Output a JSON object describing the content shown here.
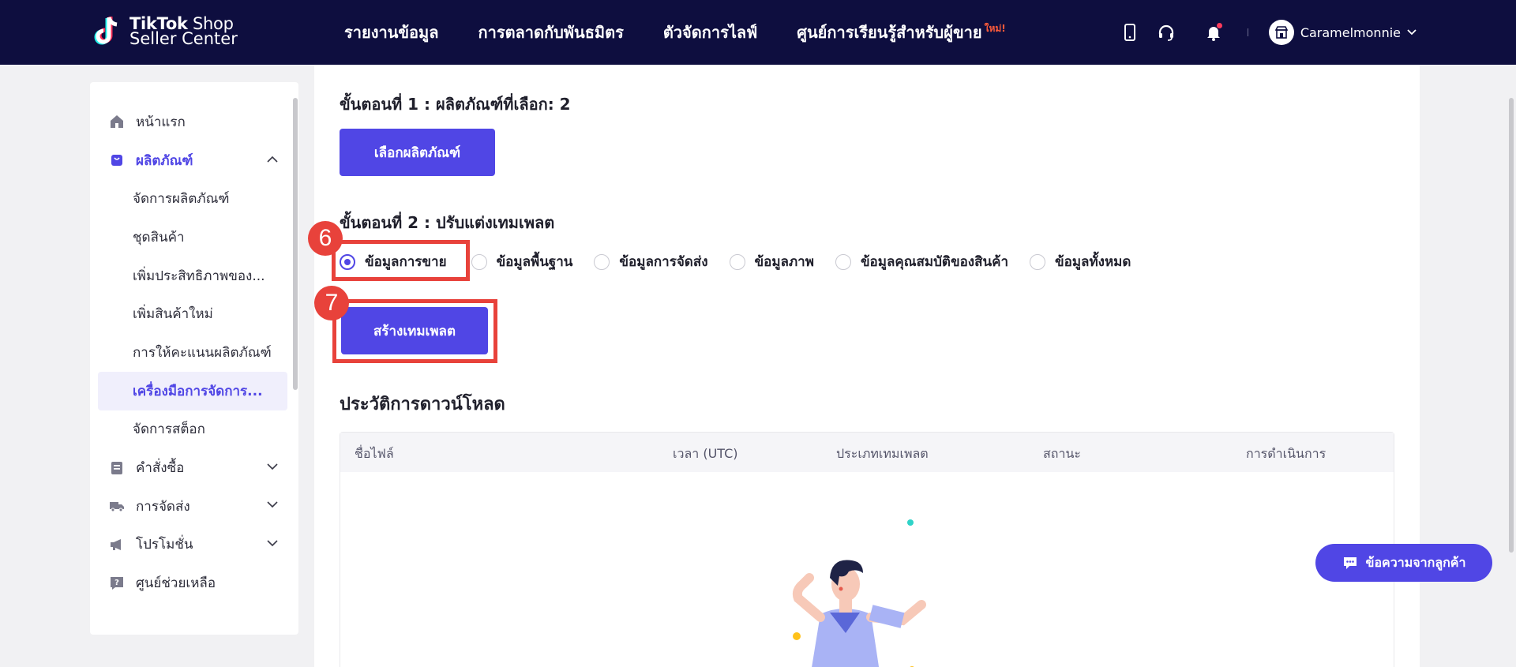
{
  "header": {
    "logo_line1_bold": "TikTok",
    "logo_line1_rest": " Shop",
    "logo_line2": "Seller Center",
    "nav": [
      {
        "label": "รายงานข้อมูล"
      },
      {
        "label": "การตลาดกับพันธมิตร"
      },
      {
        "label": "ตัวจัดการไลฟ์"
      },
      {
        "label": "ศูนย์การเรียนรู้สำหรับผู้ขาย",
        "badge": "ใหม่!"
      }
    ],
    "account_name": "Caramelmonnie"
  },
  "sidebar": {
    "items": [
      {
        "label": "หน้าแรก",
        "icon": "home-icon"
      },
      {
        "label": "ผลิตภัณฑ์",
        "icon": "bag-icon",
        "expanded": true
      },
      {
        "label": "จัดการผลิตภัณฑ์"
      },
      {
        "label": "ชุดสินค้า"
      },
      {
        "label": "เพิ่มประสิทธิภาพของ..."
      },
      {
        "label": "เพิ่มสินค้าใหม่"
      },
      {
        "label": "การให้คะแนนผลิตภัณฑ์"
      },
      {
        "label": "เครื่องมือการจัดการ...",
        "active": true
      },
      {
        "label": "จัดการสต็อก"
      },
      {
        "label": "คำสั่งซื้อ",
        "icon": "document-icon"
      },
      {
        "label": "การจัดส่ง",
        "icon": "truck-icon"
      },
      {
        "label": "โปรโมชั่น",
        "icon": "megaphone-icon"
      },
      {
        "label": "ศูนย์ช่วยเหลือ",
        "icon": "help-icon"
      }
    ]
  },
  "main": {
    "step1_title": "ขั้นตอนที่ 1 :  ผลิตภัณฑ์ที่เลือก: 2",
    "select_button": "เลือกผลิตภัณฑ์",
    "step2_title": "ขั้นตอนที่ 2 :  ปรับแต่งเทมเพลต",
    "template_options": [
      {
        "label": "ข้อมูลการขาย",
        "checked": true
      },
      {
        "label": "ข้อมูลพื้นฐาน",
        "checked": false
      },
      {
        "label": "ข้อมูลการจัดส่ง",
        "checked": false
      },
      {
        "label": "ข้อมูลภาพ",
        "checked": false
      },
      {
        "label": "ข้อมูลคุณสมบัติของสินค้า",
        "checked": false
      },
      {
        "label": "ข้อมูลทั้งหมด",
        "checked": false
      }
    ],
    "create_button": "สร้างเทมเพลต",
    "history_title": "ประวัติการดาวน์โหลด",
    "table_headers": [
      "ชื่อไฟล์",
      "เวลา (UTC)",
      "ประเภทเทมเพลต",
      "สถานะ",
      "การดำเนินการ"
    ]
  },
  "annotations": {
    "marker_6": "6",
    "marker_7": "7"
  },
  "chat_button": "ข้อความจากลูกค้า",
  "colors": {
    "navbar": "#0e0e3f",
    "accent": "#5046e5",
    "highlight": "#e8423b"
  }
}
